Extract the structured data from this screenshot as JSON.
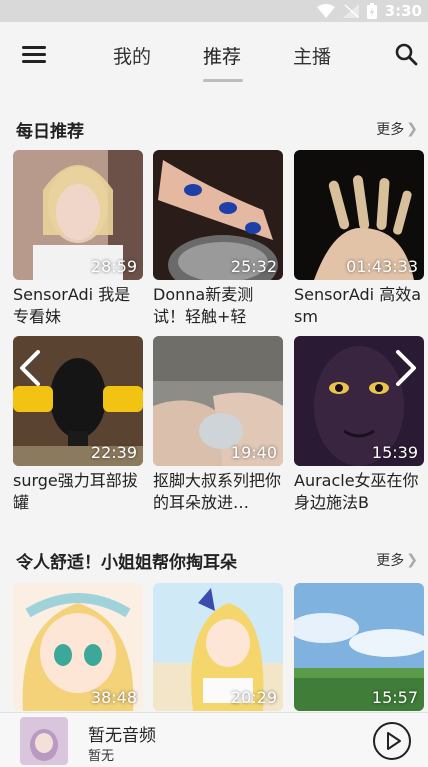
{
  "status": {
    "time": "3:30"
  },
  "nav": {
    "tabs": [
      "我的",
      "推荐",
      "主播"
    ]
  },
  "sections": [
    {
      "title": "每日推荐",
      "more": "更多",
      "cards": [
        {
          "duration": "28:59",
          "title": "SensorAdi 我是专看妹"
        },
        {
          "duration": "25:32",
          "title": "Donna新麦测试！轻触+轻"
        },
        {
          "duration": "01:43:33",
          "title": "SensorAdi 高效asm"
        },
        {
          "duration": "22:39",
          "title": "surge强力耳部拔罐"
        },
        {
          "duration": "19:40",
          "title": "抠脚大叔系列把你的耳朵放进…"
        },
        {
          "duration": "15:39",
          "title": "Auracle女巫在你身边施法B"
        }
      ]
    },
    {
      "title": "令人舒适！小姐姐帮你掏耳朵",
      "more": "更多",
      "cards": [
        {
          "duration": "38:48"
        },
        {
          "duration": "20:29"
        },
        {
          "duration": "15:57"
        }
      ]
    }
  ],
  "player": {
    "title": "暂无音频",
    "subtitle": "暂无"
  }
}
